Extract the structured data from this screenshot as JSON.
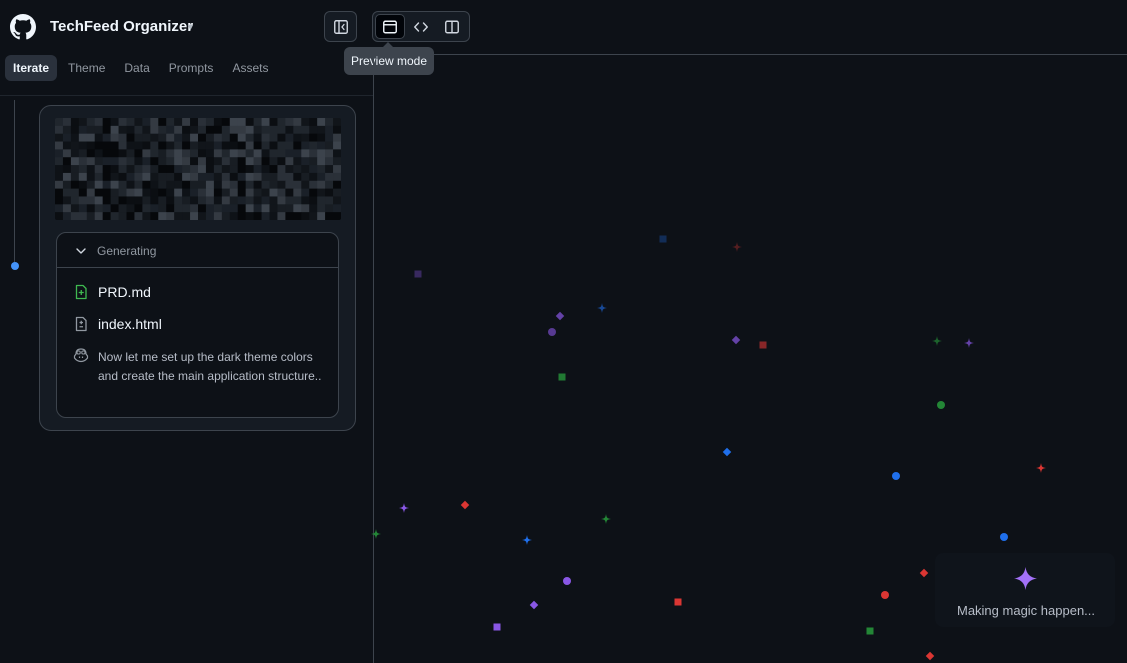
{
  "header": {
    "app_title": "TechFeed Organizer",
    "logo_icon": "github-icon",
    "title_caret_icon": "caret-down-icon",
    "sidebar_toggle_icon": "sidebar-toggle-icon"
  },
  "view_modes": {
    "buttons": [
      {
        "icon": "browser-window-icon",
        "active": true
      },
      {
        "icon": "code-icon",
        "active": false
      },
      {
        "icon": "split-view-icon",
        "active": false
      }
    ],
    "tooltip": "Preview mode"
  },
  "tabs": [
    {
      "label": "Iterate",
      "active": true
    },
    {
      "label": "Theme",
      "active": false
    },
    {
      "label": "Data",
      "active": false
    },
    {
      "label": "Prompts",
      "active": false
    },
    {
      "label": "Assets",
      "active": false
    }
  ],
  "generation": {
    "status_label": "Generating",
    "files": [
      {
        "name": "PRD.md",
        "icon": "file-added-icon",
        "icon_color": "#3fb950"
      },
      {
        "name": "index.html",
        "icon": "file-diff-icon",
        "icon_color": "#9198a1"
      }
    ],
    "message_icon": "copilot-icon",
    "message": "Now let me set up the dark theme colors and create the main application structure.."
  },
  "preview": {
    "loading_text": "Making magic happen...",
    "loading_icon": "sparkle-icon",
    "accent_color": "#a371f7"
  },
  "colors": {
    "background": "#0d1117",
    "border": "#3d444d",
    "timeline_dot": "#4493f8",
    "particle_red": "#da3633",
    "particle_green": "#238636",
    "particle_blue": "#1f6feb",
    "particle_purple": "#8957e5"
  }
}
